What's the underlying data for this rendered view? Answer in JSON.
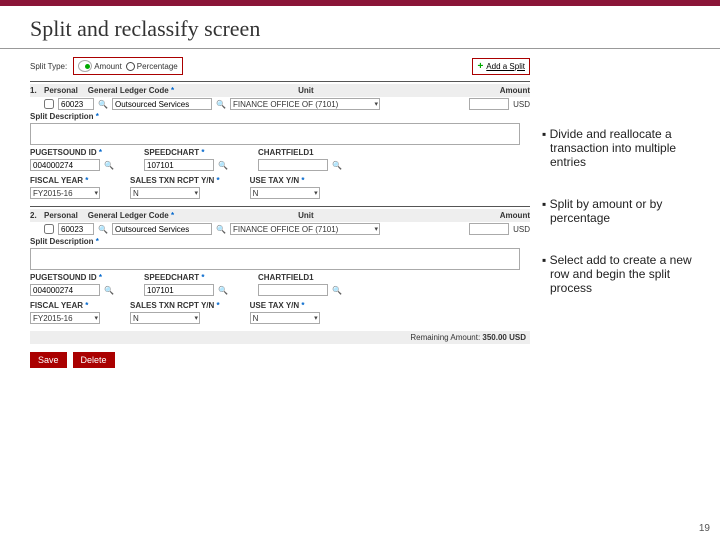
{
  "title": "Split and reclassify screen",
  "splitType": {
    "label": "Split Type:",
    "amount": "Amount",
    "percentage": "Percentage"
  },
  "addSplit": "Add a Split",
  "headers": {
    "personal": "Personal",
    "glc": "General Ledger Code",
    "unit": "Unit",
    "amount": "Amount"
  },
  "codeVal": "60023",
  "codeDesc": "Outsourced Services",
  "unitVal": "FINANCE OFFICE OF (7101)",
  "currency": "USD",
  "splitDesc": "Split Description",
  "fields": {
    "psid": {
      "label": "PUGETSOUND ID",
      "val": "004000274"
    },
    "speed": {
      "label": "SPEEDCHART",
      "val": "107101"
    },
    "chart": {
      "label": "CHARTFIELD1",
      "val": ""
    },
    "fy": {
      "label": "FISCAL YEAR",
      "val": "FY2015-16"
    },
    "tax": {
      "label": "SALES TXN RCPT Y/N",
      "val": "N"
    },
    "use": {
      "label": "USE TAX Y/N",
      "val": "N"
    }
  },
  "remaining": {
    "label": "Remaining Amount:",
    "val": "350.00 USD"
  },
  "buttons": {
    "save": "Save",
    "delete": "Delete"
  },
  "bullets": [
    "Divide and reallocate a transaction into multiple entries",
    "Split by amount or by percentage",
    "Select add to create a new row and begin the split process"
  ],
  "page": "19",
  "nums": {
    "n1": "1.",
    "n2": "2."
  }
}
